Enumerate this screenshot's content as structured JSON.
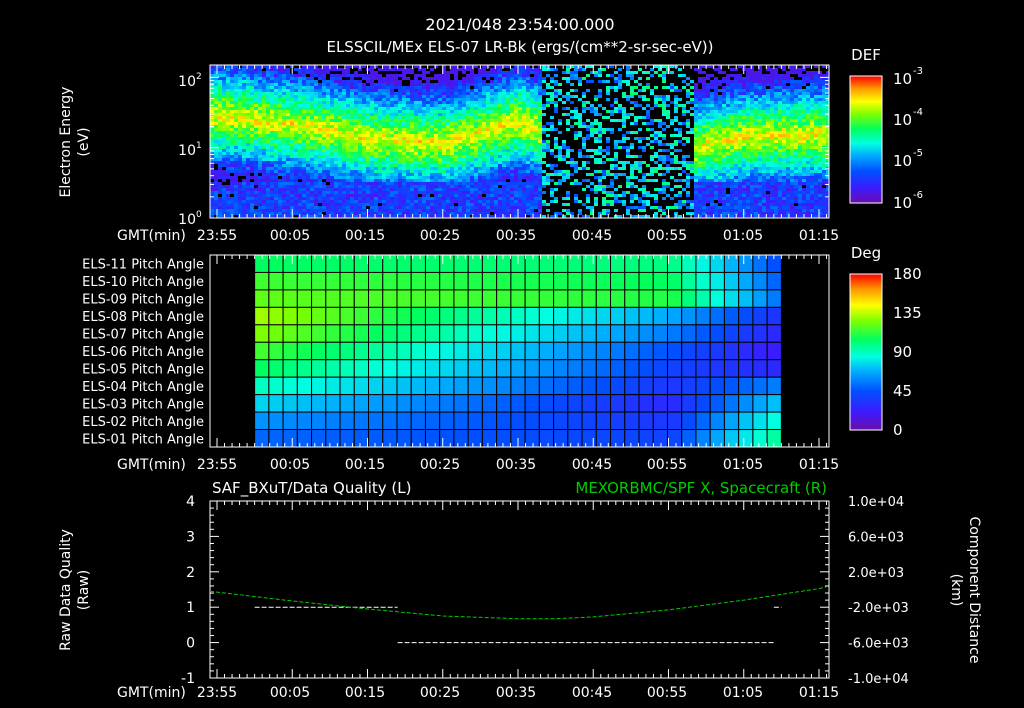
{
  "header": {
    "title": "2021/048 23:54:00.000",
    "subtitle": "ELSSCIL/MEx ELS-07 LR-Bk  (ergs/(cm**2-sr-sec-eV))"
  },
  "time_axis": {
    "label": "GMT(min)",
    "ticks": [
      "23:55",
      "00:05",
      "00:15",
      "00:25",
      "00:35",
      "00:45",
      "00:55",
      "01:05",
      "01:15"
    ]
  },
  "colors": {
    "colormap": [
      "#6a0dad",
      "#3b1cff",
      "#0050ff",
      "#00a8ff",
      "#00ffe0",
      "#00ff60",
      "#7dff00",
      "#ffff00",
      "#ff9a00",
      "#ff0000"
    ],
    "quality_line": "#ffffff",
    "spacecraft_line": "#00cc00",
    "background": "#000000"
  },
  "chart_data": [
    {
      "type": "heatmap",
      "title": "ELSSCIL/MEx ELS-07 LR-Bk  (ergs/(cm**2-sr-sec-eV))",
      "ylabel": [
        "Electron Energy",
        "(eV)"
      ],
      "y_scale": "log",
      "ylim": [
        1,
        150
      ],
      "y_ticks": [
        {
          "base": "10",
          "exp": "0"
        },
        {
          "base": "10",
          "exp": "1"
        },
        {
          "base": "10",
          "exp": "2"
        }
      ],
      "colorbar": {
        "label": "DEF",
        "scale": "log",
        "range": [
          1e-06,
          0.001
        ],
        "ticks": [
          {
            "base": "10",
            "exp": "-3"
          },
          {
            "base": "10",
            "exp": "-4"
          },
          {
            "base": "10",
            "exp": "-5"
          },
          {
            "base": "10",
            "exp": "-6"
          }
        ]
      },
      "peak_energy_eV_by_tick": {
        "23:55": 30,
        "00:05": 22,
        "00:15": 14,
        "00:25": 12,
        "00:35": 25,
        "00:45": 8,
        "00:55": 9,
        "01:05": 15,
        "01:15": 16
      },
      "data_gap": "00:38-00:58 sparse"
    },
    {
      "type": "heatmap",
      "colorbar": {
        "label": "Deg",
        "ticks": [
          "180",
          "135",
          "90",
          "45",
          "0"
        ],
        "range": [
          0,
          180
        ]
      },
      "rows": [
        "ELS-11 Pitch Angle",
        "ELS-10 Pitch Angle",
        "ELS-09 Pitch Angle",
        "ELS-08 Pitch Angle",
        "ELS-07 Pitch Angle",
        "ELS-06 Pitch Angle",
        "ELS-05 Pitch Angle",
        "ELS-04 Pitch Angle",
        "ELS-03 Pitch Angle",
        "ELS-02 Pitch Angle",
        "ELS-01 Pitch Angle"
      ],
      "time_start": "00:00",
      "time_end": "01:10",
      "columns": 37,
      "pitch_angle_deg": [
        {
          "row": "ELS-11",
          "start": 100,
          "end": 95,
          "late": 40
        },
        {
          "row": "ELS-10",
          "start": 110,
          "end": 100,
          "late": 45
        },
        {
          "row": "ELS-09",
          "start": 115,
          "end": 105,
          "late": 50
        },
        {
          "row": "ELS-08",
          "start": 125,
          "end": 60,
          "late": 30
        },
        {
          "row": "ELS-07",
          "start": 120,
          "end": 50,
          "late": 25
        },
        {
          "row": "ELS-06",
          "start": 110,
          "end": 40,
          "late": 20
        },
        {
          "row": "ELS-05",
          "start": 100,
          "end": 35,
          "late": 25
        },
        {
          "row": "ELS-04",
          "start": 85,
          "end": 30,
          "late": 50
        },
        {
          "row": "ELS-03",
          "start": 70,
          "end": 25,
          "late": 65
        },
        {
          "row": "ELS-02",
          "start": 55,
          "end": 30,
          "late": 80
        },
        {
          "row": "ELS-01",
          "start": 45,
          "end": 35,
          "late": 90
        }
      ]
    },
    {
      "type": "line",
      "title_left": "SAF_BXuT/Data Quality (L)",
      "title_right": "MEXORBMC/SPF X, Spacecraft (R)",
      "ylabel_left": [
        "Raw Data Quality",
        "(Raw)"
      ],
      "ylabel_right": [
        "Component Distance",
        "(km)"
      ],
      "ylim_left": [
        -1,
        4
      ],
      "yticks_left": [
        "4",
        "3",
        "2",
        "1",
        "0",
        "-1"
      ],
      "ylim_right": [
        -10000,
        10000
      ],
      "yticks_right": [
        "1.0e+04",
        "6.0e+03",
        "2.0e+03",
        "-2.0e+03",
        "-6.0e+03",
        "-1.0e+04"
      ],
      "series": [
        {
          "name": "SAF_BXuT/Data Quality",
          "axis": "left",
          "segments": [
            {
              "x": [
                "00:00",
                "00:19"
              ],
              "y": [
                1,
                1
              ]
            },
            {
              "x": [
                "00:19",
                "01:09"
              ],
              "y": [
                0,
                0
              ]
            },
            {
              "x": [
                "01:09",
                "01:10"
              ],
              "y": [
                1,
                1
              ]
            }
          ]
        },
        {
          "name": "MEXORBMC/SPF X, Spacecraft",
          "axis": "right",
          "x": [
            "23:53",
            "00:05",
            "00:15",
            "00:25",
            "00:35",
            "00:40",
            "00:45",
            "00:55",
            "01:05",
            "01:15",
            "01:16"
          ],
          "y": [
            -200,
            -1300,
            -2200,
            -3000,
            -3300,
            -3300,
            -3100,
            -2300,
            -1200,
            100,
            300
          ]
        }
      ]
    }
  ]
}
